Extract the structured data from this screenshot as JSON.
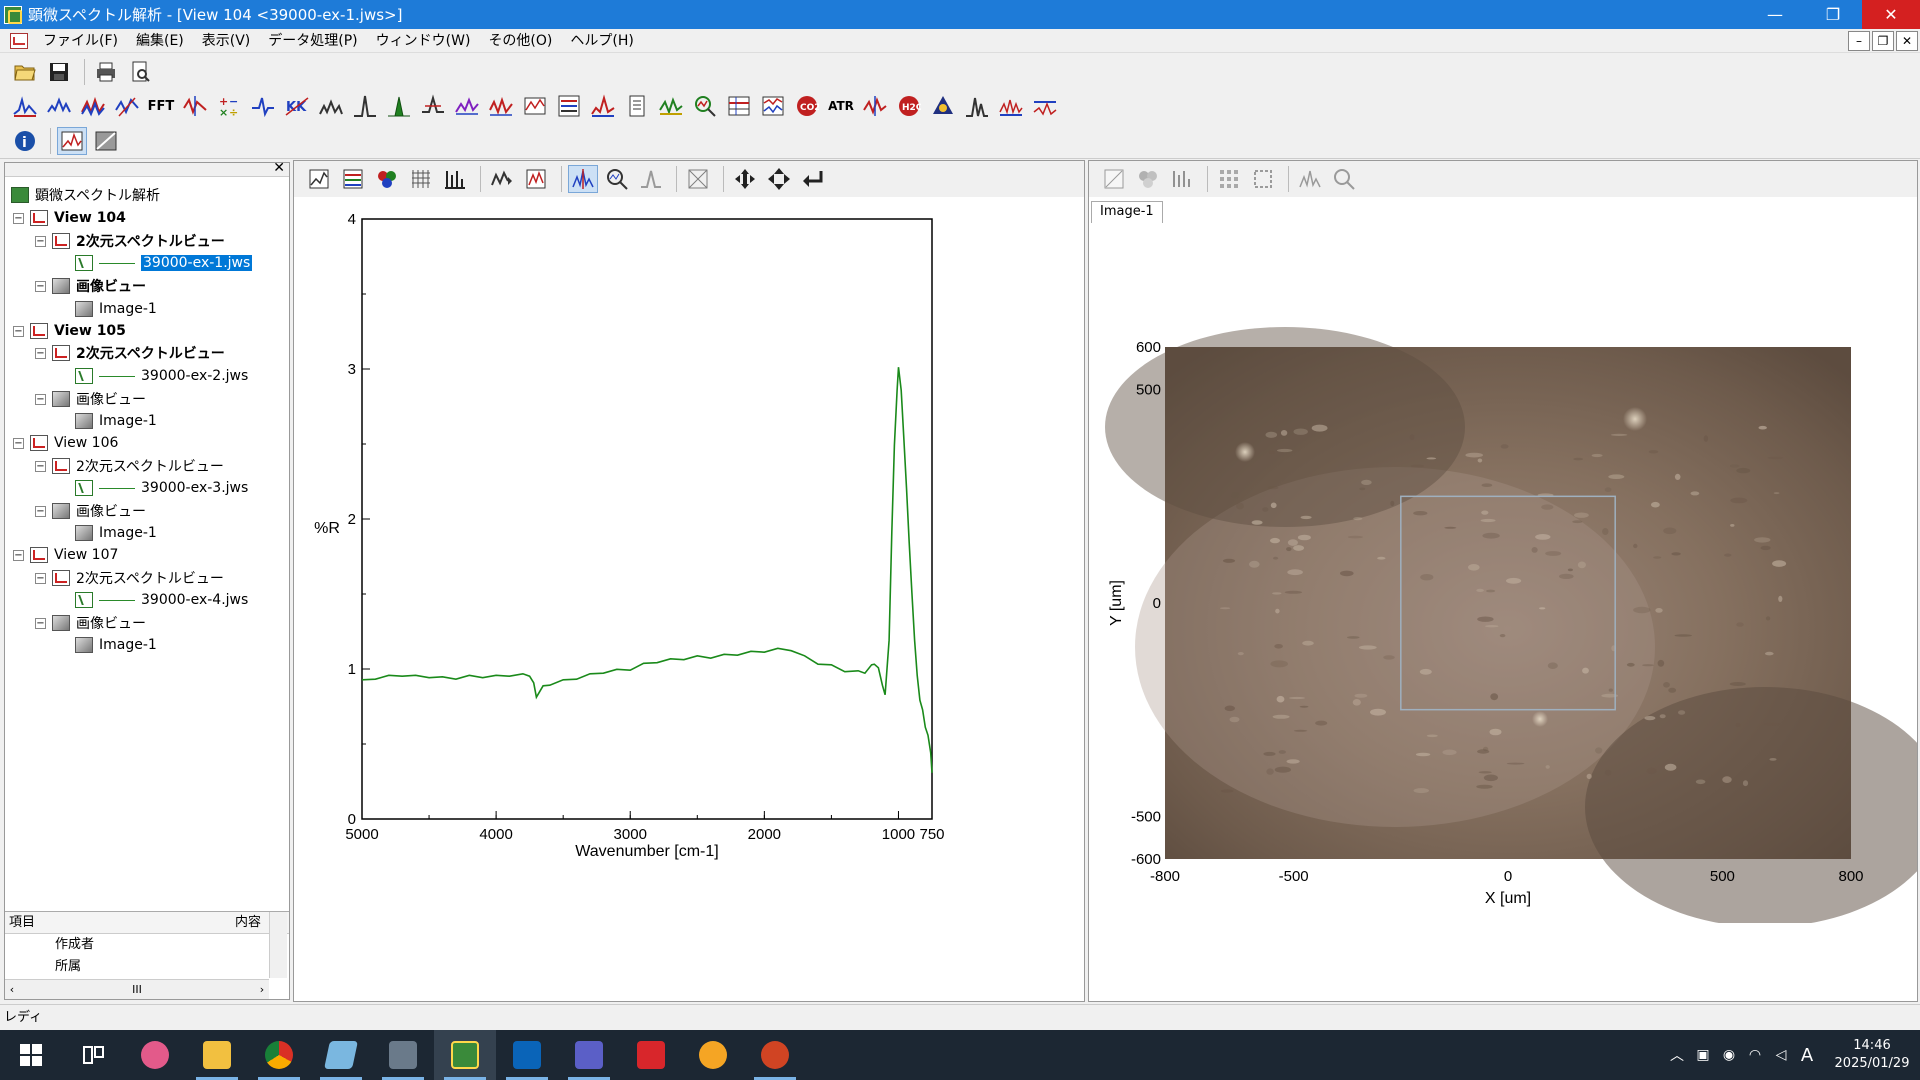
{
  "window": {
    "title": "顕微スペクトル解析 - [View 104 <39000-ex-1.jws>]",
    "minimize": "—",
    "maximize": "❐",
    "close": "✕"
  },
  "menu": {
    "items": [
      "ファイル(F)",
      "編集(E)",
      "表示(V)",
      "データ処理(P)",
      "ウィンドウ(W)",
      "その他(O)",
      "ヘルプ(H)"
    ],
    "mdi_min": "–",
    "mdi_restore": "❐",
    "mdi_close": "✕"
  },
  "toolbar1": {
    "icons": [
      "open-folder-icon",
      "save-disk-icon",
      "print-icon",
      "print-preview-icon"
    ]
  },
  "toolbar2": {
    "fft_label": "FFT",
    "atr_label": "ATR"
  },
  "tree": {
    "root": "顕微スペクトル解析",
    "views": [
      {
        "name": "View 104",
        "spectrum_view": "2次元スペクトルビュー",
        "file": "39000-ex-1.jws",
        "image_view": "画像ビュー",
        "image": "Image-1",
        "selected": true
      },
      {
        "name": "View 105",
        "spectrum_view": "2次元スペクトルビュー",
        "file": "39000-ex-2.jws",
        "image_view": "画像ビュー",
        "image": "Image-1",
        "selected": false
      },
      {
        "name": "View 106",
        "spectrum_view": "2次元スペクトルビュー",
        "file": "39000-ex-3.jws",
        "image_view": "画像ビュー",
        "image": "Image-1",
        "selected": false
      },
      {
        "name": "View 107",
        "spectrum_view": "2次元スペクトルビュー",
        "file": "39000-ex-4.jws",
        "image_view": "画像ビュー",
        "image": "Image-1",
        "selected": false
      }
    ]
  },
  "properties": {
    "col_item": "項目",
    "col_content": "内容",
    "rows": [
      "作成者",
      "所属"
    ],
    "hscroll_thumb": "III"
  },
  "image_view": {
    "tab": "Image-1"
  },
  "status": {
    "text": "レディ"
  },
  "taskbar": {
    "clock_time": "14:46",
    "clock_date": "2025/01/29",
    "ime": "A"
  },
  "colors": {
    "titlebar": "#1e7bd8",
    "spectrum_line": "#1a8a1a",
    "selection": "#0078d7"
  },
  "chart_data": [
    {
      "type": "line",
      "title": "",
      "xlabel": "Wavenumber [cm-1]",
      "ylabel": "%R",
      "xlim": [
        5000,
        750
      ],
      "ylim": [
        0,
        4
      ],
      "xticks": [
        5000,
        4000,
        3000,
        2000,
        1000,
        750
      ],
      "yticks": [
        0,
        1,
        2,
        3,
        4
      ],
      "series": [
        {
          "color": "#1a8a1a",
          "x": [
            5000,
            4900,
            4800,
            4700,
            4600,
            4500,
            4400,
            4300,
            4200,
            4100,
            4000,
            3900,
            3800,
            3750,
            3720,
            3700,
            3650,
            3600,
            3500,
            3400,
            3300,
            3200,
            3100,
            3000,
            2900,
            2800,
            2700,
            2600,
            2500,
            2400,
            2300,
            2200,
            2100,
            2000,
            1900,
            1800,
            1700,
            1600,
            1500,
            1400,
            1300,
            1250,
            1200,
            1180,
            1150,
            1120,
            1100,
            1070,
            1050,
            1030,
            1010,
            1000,
            980,
            960,
            940,
            920,
            900,
            880,
            860,
            840,
            820,
            800,
            780,
            760,
            750
          ],
          "y": [
            0.92,
            0.94,
            0.95,
            0.96,
            0.95,
            0.95,
            0.94,
            0.94,
            0.95,
            0.95,
            0.95,
            0.96,
            0.96,
            0.96,
            0.9,
            0.82,
            0.88,
            0.9,
            0.92,
            0.94,
            0.96,
            0.98,
            0.99,
            1.0,
            1.03,
            1.05,
            1.06,
            1.07,
            1.08,
            1.08,
            1.09,
            1.1,
            1.11,
            1.12,
            1.13,
            1.13,
            1.08,
            1.04,
            1.02,
            0.99,
            0.98,
            0.98,
            1.02,
            1.04,
            1.0,
            0.9,
            0.82,
            1.2,
            1.9,
            2.5,
            2.85,
            3.02,
            2.85,
            2.55,
            2.2,
            1.85,
            1.5,
            1.2,
            0.95,
            0.8,
            0.72,
            0.62,
            0.55,
            0.45,
            0.3
          ]
        }
      ]
    },
    {
      "type": "image",
      "xlabel": "X [um]",
      "ylabel": "Y [um]",
      "xlim": [
        -800,
        800
      ],
      "ylim": [
        -600,
        600
      ],
      "xticks": [
        -800,
        -500,
        0,
        500,
        800
      ],
      "yticks": [
        600,
        500,
        0,
        -500,
        -600
      ],
      "roi": {
        "x": [
          -250,
          250
        ],
        "y": [
          -250,
          250
        ]
      }
    }
  ]
}
